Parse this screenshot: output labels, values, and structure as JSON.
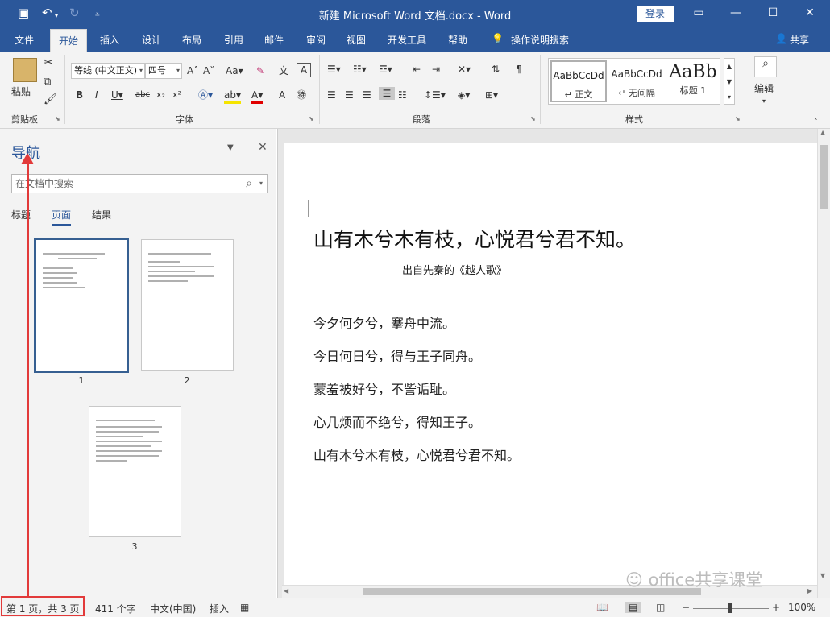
{
  "titlebar": {
    "title": "新建 Microsoft Word 文档.docx  -  Word",
    "login": "登录"
  },
  "tabs": [
    "文件",
    "开始",
    "插入",
    "设计",
    "布局",
    "引用",
    "邮件",
    "审阅",
    "视图",
    "开发工具",
    "帮助",
    "操作说明搜索",
    "共享"
  ],
  "ribbon": {
    "clipboard": {
      "label": "剪贴板",
      "paste": "粘贴"
    },
    "font": {
      "label": "字体",
      "font_name": "等线 (中文正文)",
      "font_size": "四号"
    },
    "paragraph": {
      "label": "段落"
    },
    "styles": {
      "label": "样式",
      "items": [
        {
          "preview": "AaBbCcDd",
          "name": "↵ 正文"
        },
        {
          "preview": "AaBbCcDd",
          "name": "↵ 无间隔"
        },
        {
          "preview": "AaBb",
          "name": "标题 1"
        }
      ]
    },
    "editing": {
      "label": "编辑"
    }
  },
  "nav": {
    "title": "导航",
    "search_placeholder": "在文档中搜索",
    "tabs": [
      "标题",
      "页面",
      "结果"
    ],
    "thumbs": [
      "1",
      "2",
      "3"
    ]
  },
  "doc": {
    "title": "山有木兮木有枝，心悦君兮君不知。",
    "subtitle": "出自先秦的《越人歌》",
    "lines": [
      "今夕何夕兮，搴舟中流。",
      "今日何日兮，得与王子同舟。",
      "蒙羞被好兮，不訾诟耻。",
      "心几烦而不绝兮，得知王子。",
      "山有木兮木有枝，心悦君兮君不知。"
    ]
  },
  "status": {
    "page": "第 1 页，共 3 页",
    "words": "411 个字",
    "lang": "中文(中国)",
    "mode": "插入",
    "zoom": "100%"
  },
  "watermark": "office共享课堂"
}
